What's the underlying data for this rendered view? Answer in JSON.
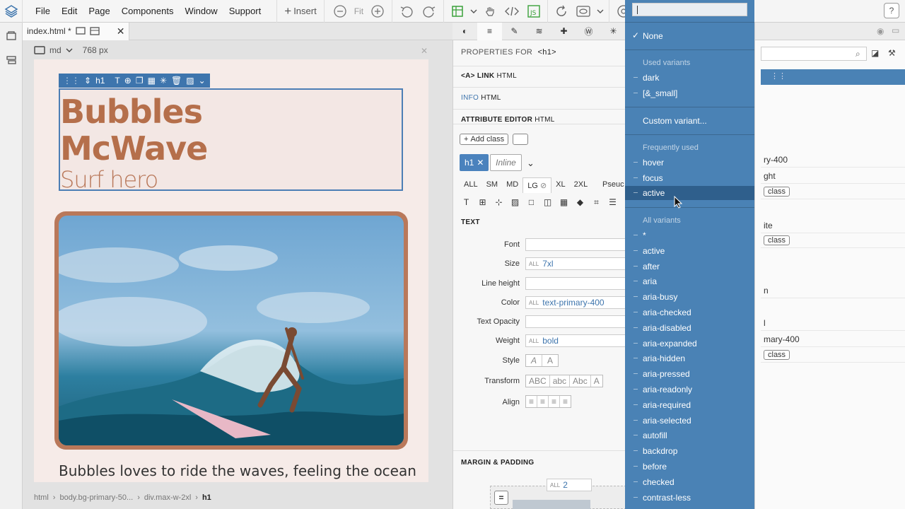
{
  "menubar": {
    "items": [
      "File",
      "Edit",
      "Page",
      "Components",
      "Window",
      "Support"
    ],
    "insert_label": "Insert",
    "fit_label": "Fit"
  },
  "filetab": {
    "name": "index.html *"
  },
  "device": {
    "breakpoint": "md",
    "width": "768 px"
  },
  "page": {
    "heading_line1": "Bubbles",
    "heading_line2": "McWave",
    "heading_sub": "Surf hero",
    "body": "Bubbles loves to ride the waves, feeling the ocean",
    "selected_tag": "h1"
  },
  "breadcrumb": [
    "html",
    "body.bg-primary-50...",
    "div.max-w-2xl",
    "h1"
  ],
  "properties": {
    "title": "PROPERTIES FOR",
    "tag": "<h1>",
    "sections": [
      {
        "name": "<A> LINK",
        "sub": "HTML"
      },
      {
        "name": "INFO",
        "sub": "HTML"
      },
      {
        "name": "ATTRIBUTE EDITOR",
        "sub": "HTML"
      }
    ],
    "add_class": "Add class",
    "chip_class": "h1",
    "chip_inline": "Inline",
    "breakpoints": [
      "ALL",
      "SM",
      "MD",
      "LG",
      "XL",
      "2XL"
    ],
    "active_breakpoint": "LG",
    "pseudo_label": "Pseuc",
    "text_section": "TEXT",
    "fields": [
      {
        "label": "Font",
        "value": ""
      },
      {
        "label": "Size",
        "value": "7xl"
      },
      {
        "label": "Line height",
        "value": ""
      },
      {
        "label": "Color",
        "value": "text-primary-400"
      },
      {
        "label": "Text Opacity",
        "value": ""
      },
      {
        "label": "Weight",
        "value": "bold"
      }
    ],
    "all_prefix": "ALL",
    "style_label": "Style",
    "style_options": [
      "A",
      "A"
    ],
    "transform_label": "Transform",
    "transform_options": [
      "ABC",
      "abc",
      "Abc",
      "A"
    ],
    "align_label": "Align",
    "margin_section": "MARGIN & PADDING",
    "spacing_value": "2"
  },
  "dropdown": {
    "none_label": "None",
    "used_heading": "Used variants",
    "used": [
      "dark",
      "[&_small]"
    ],
    "custom": "Custom variant...",
    "frequent_heading": "Frequently used",
    "frequent": [
      "hover",
      "focus",
      "active"
    ],
    "selected": "active",
    "all_heading": "All variants",
    "all": [
      "*",
      "active",
      "after",
      "aria",
      "aria-busy",
      "aria-checked",
      "aria-disabled",
      "aria-expanded",
      "aria-hidden",
      "aria-pressed",
      "aria-readonly",
      "aria-required",
      "aria-selected",
      "autofill",
      "backdrop",
      "before",
      "checked",
      "contrast-less"
    ]
  },
  "right_panel": {
    "rows": [
      "ry-400",
      "ght",
      "class",
      "ite",
      "class",
      "n",
      "l",
      "mary-400",
      "class"
    ]
  },
  "colors": {
    "accent": "#4a82b5",
    "heading": "#b56f4b",
    "page_bg": "#f6ebe8"
  }
}
